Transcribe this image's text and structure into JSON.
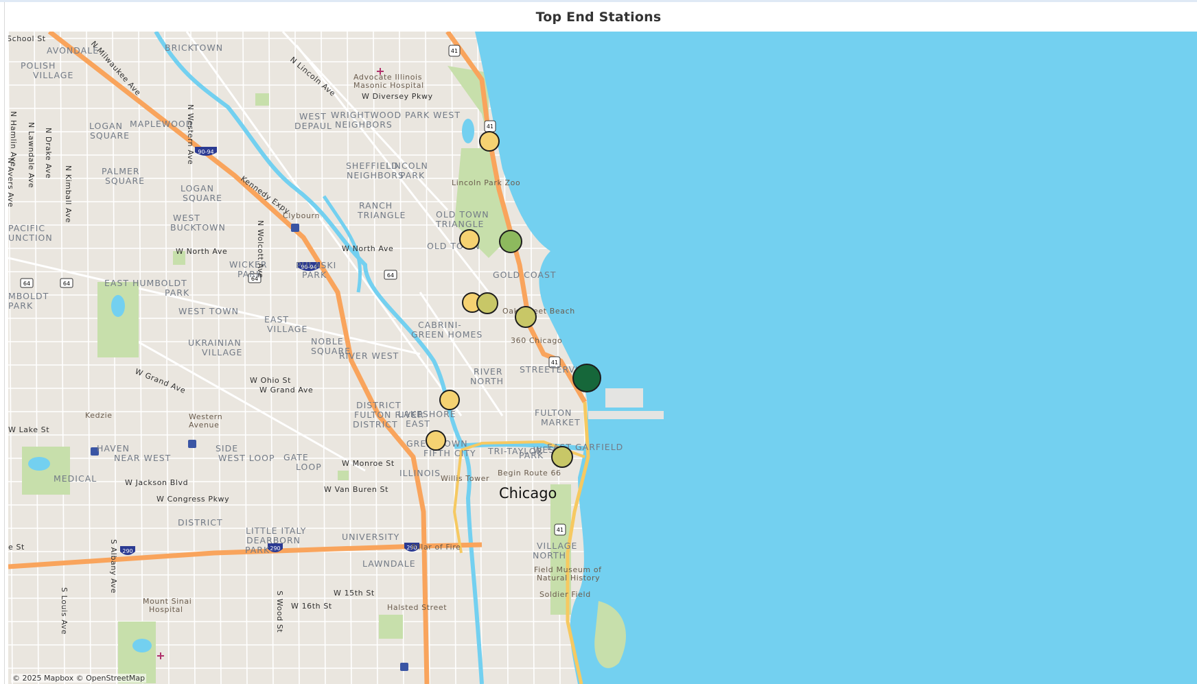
{
  "title": "Top End Stations",
  "attribution": "© 2025 Mapbox © OpenStreetMap",
  "colors": {
    "water": "#73d0f0",
    "land": "#eae6df",
    "park": "#c7dfab",
    "highway": "#f9a45c",
    "lakeshore": "#f6c961",
    "stop_low": "#f5d272",
    "stop_mid": "#c8c767",
    "stop_high": "#8db95e",
    "stop_top": "#16673a"
  },
  "stations": [
    {
      "level": "low"
    },
    {
      "level": "low"
    },
    {
      "level": "high"
    },
    {
      "level": "low"
    },
    {
      "level": "mid"
    },
    {
      "level": "mid"
    },
    {
      "level": "top"
    },
    {
      "level": "low"
    },
    {
      "level": "low"
    },
    {
      "level": "mid"
    }
  ],
  "labels": {
    "neighborhoods": [
      "AVONDALE",
      "BRICKTOWN",
      "POLISH",
      "VILLAGE",
      "LOGAN",
      "SQUARE",
      "MAPLEWOOD",
      "WEST",
      "DEPAUL",
      "WRIGHTWOOD",
      "NEIGHBORS",
      "PARK WEST",
      "SHEFFIELD",
      "NEIGHBORS",
      "LINCOLN",
      "PARK",
      "PALMER",
      "SQUARE",
      "LOGAN",
      "SQUARE",
      "RANCH",
      "TRIANGLE",
      "OLD TOWN",
      "TRIANGLE",
      "PACIFIC",
      "UNCTION",
      "WEST",
      "BUCKTOWN",
      "WICKER",
      "PARK",
      "PULASKI",
      "PARK",
      "OLD TOWN",
      "GOLD COAST",
      "EAST HUMBOLDT",
      "PARK",
      "MBOLDT",
      "PARK",
      "WEST TOWN",
      "EAST",
      "VILLAGE",
      "CABRINI-",
      "GREEN HOMES",
      "UKRAINIAN",
      "VILLAGE",
      "NOBLE",
      "SQUARE",
      "RIVER WEST",
      "RIVER",
      "NORTH",
      "STREETERVILLE",
      "FULTON",
      "MARKET",
      "DISTRICT",
      "FULTON RIVER",
      "DISTRICT",
      "LAKESHORE",
      "EAST",
      "EAST GARFIELD",
      "PARK",
      "WEST",
      "HAVEN",
      "NEAR WEST",
      "SIDE",
      "WEST LOOP",
      "GATE",
      "LOOP",
      "GREEKTOWN",
      "FIFTH CITY",
      "TRI-TAYLOR",
      "ILLINOIS",
      "MEDICAL",
      "DISTRICT",
      "LITTLE ITALY",
      "DEARBORN",
      "PARK",
      "UNIVERSITY",
      "VILLAGE",
      "NORTH",
      "LAWNDALE"
    ],
    "streets": [
      "School St",
      "N Milwaukee Ave",
      "N Lincoln Ave",
      "W Diversey Pkwy",
      "N Western Ave",
      "N Hamlin Ave",
      "N Lawndale Ave",
      "N Drake Ave",
      "N Kimball Ave",
      "N Avers Ave",
      "Kennedy Expy",
      "N Wolcott Ave",
      "W North Ave",
      "W North Ave",
      "W Grand Ave",
      "W Ohio St",
      "W Grand Ave",
      "W Lake St",
      "W Monroe St",
      "W Jackson Blvd",
      "W Van Buren St",
      "W Congress Pkwy",
      "S Albany Ave",
      "S Louis Ave",
      "S Wood St",
      "W 15th St",
      "W 16th St",
      "e St"
    ],
    "pois": [
      "Advocate Illinois",
      "Masonic Hospital",
      "Lincoln Park Zoo",
      "Clybourn",
      "Oak Street Beach",
      "360 Chicago",
      "Western",
      "Avenue",
      "Kedzie",
      "Willis Tower",
      "Begin Route 66",
      "Pillar of Fire",
      "Field Museum of",
      "Natural History",
      "Soldier Field",
      "Mount Sinai",
      "Hospital",
      "Halsted Street"
    ],
    "city": "Chicago",
    "shields": [
      "41",
      "41",
      "41",
      "41",
      "64",
      "64",
      "64",
      "64",
      "90-94",
      "90-94",
      "290",
      "290",
      "290"
    ]
  }
}
